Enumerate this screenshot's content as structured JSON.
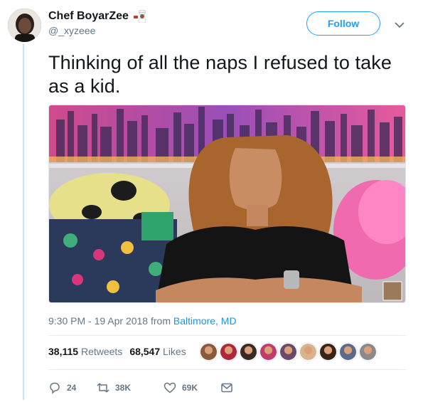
{
  "user": {
    "name": "Chef BoyarZee",
    "handle": "@_xyzeee"
  },
  "follow_label": "Follow",
  "tweet": {
    "text": "Thinking of all the naps I refused to take as a kid."
  },
  "meta": {
    "time": "9:30 PM - 19 Apr 2018",
    "from": "from",
    "location": "Baltimore, MD"
  },
  "stats": {
    "retweets_count": "38,115",
    "retweets_label": "Retweets",
    "likes_count": "68,547",
    "likes_label": "Likes"
  },
  "likers": [
    "#8a5a3c",
    "#b0263a",
    "#3a2a24",
    "#c23b6b",
    "#6a4a6a",
    "#d9b38c",
    "#3a2418",
    "#5a6a8a",
    "#8a8a8a"
  ],
  "actions": {
    "replies": "24",
    "retweets": "38K",
    "likes": "69K"
  },
  "colors": {
    "accent": "#1da1f2",
    "link": "#1b95e0",
    "muted": "#657786",
    "thread": "#c4e4f8"
  }
}
